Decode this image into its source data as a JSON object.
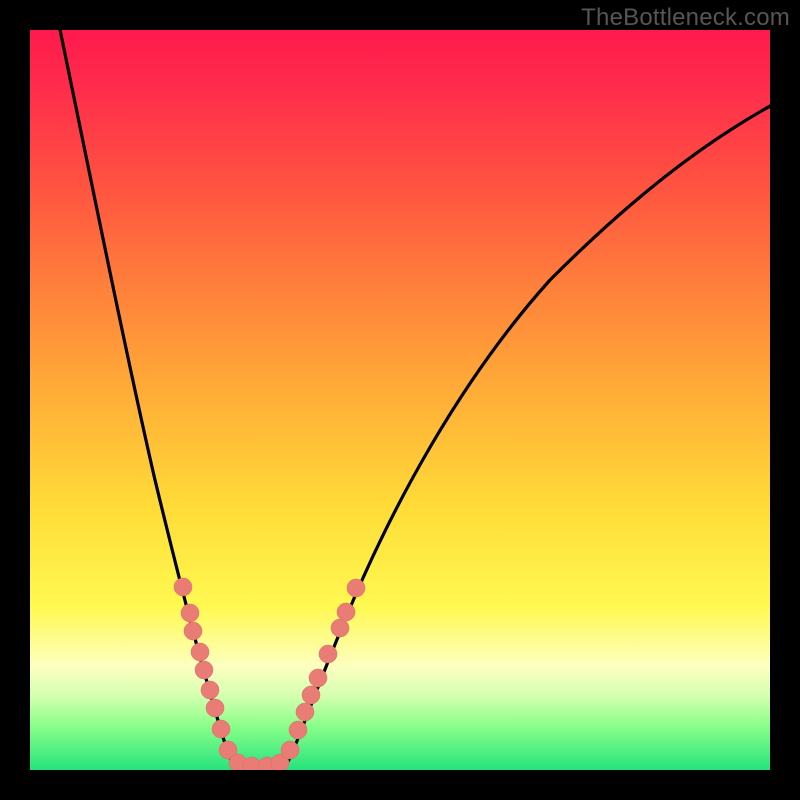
{
  "watermark": "TheBottleneck.com",
  "chart_data": {
    "type": "line",
    "title": "",
    "xlabel": "",
    "ylabel": "",
    "xlim": [
      0,
      100
    ],
    "ylim": [
      0,
      100
    ],
    "series": [
      {
        "name": "bottleneck-curve",
        "x": [
          4,
          10,
          16,
          22,
          26,
          30,
          33,
          36,
          40,
          48,
          58,
          70,
          82,
          94,
          100
        ],
        "values": [
          100,
          80,
          58,
          38,
          22,
          8,
          1,
          1,
          10,
          30,
          50,
          68,
          80,
          88,
          90
        ]
      }
    ],
    "points": {
      "name": "highlighted-dots",
      "color": "#e97c75",
      "x": [
        20.7,
        21.6,
        22.0,
        23.0,
        23.5,
        24.3,
        25.0,
        25.8,
        26.8,
        28.1,
        30.0,
        32.0,
        33.8,
        35.1,
        36.2,
        37.2,
        38.0,
        38.9,
        40.3,
        41.9,
        42.7,
        44.1
      ],
      "values": [
        24.7,
        21.2,
        18.8,
        15.9,
        13.5,
        10.8,
        8.4,
        5.5,
        2.7,
        0.9,
        0.5,
        0.5,
        0.9,
        2.7,
        5.4,
        7.8,
        10.1,
        12.4,
        15.7,
        19.2,
        21.4,
        24.6
      ]
    },
    "background_gradient": {
      "top": "#ff1a4d",
      "upper_mid": "#ffb037",
      "lower_mid": "#fff952",
      "bottom": "#26e37d"
    }
  }
}
